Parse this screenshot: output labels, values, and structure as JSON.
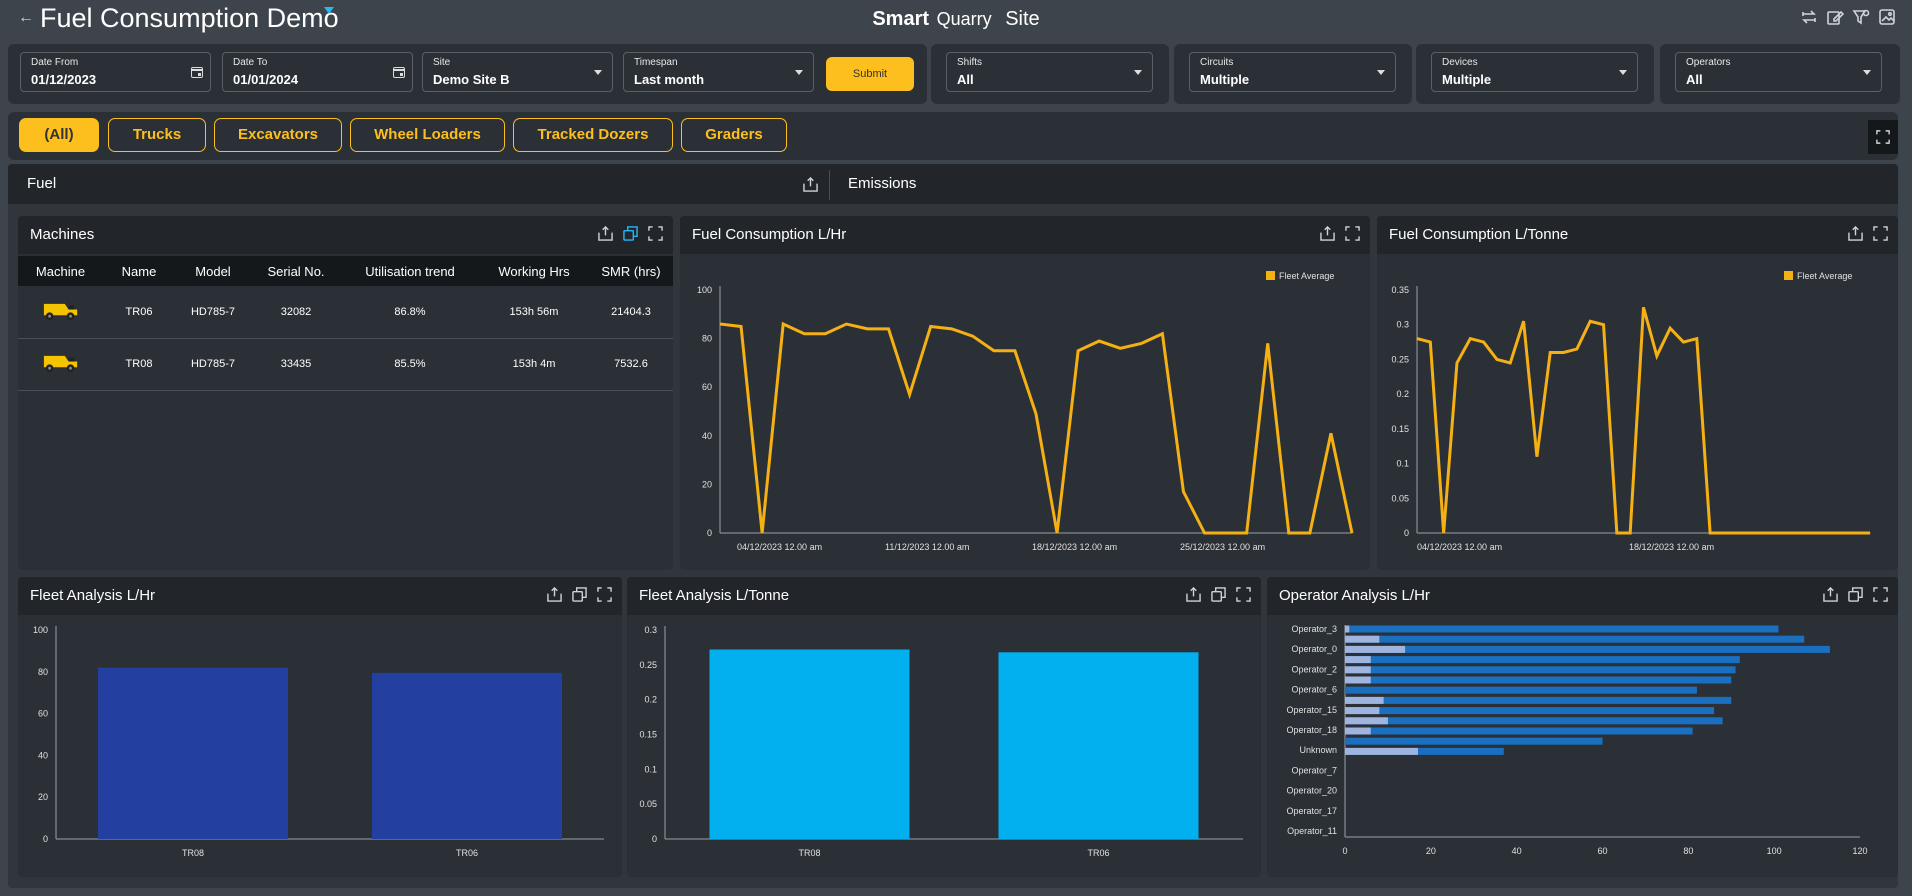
{
  "header": {
    "title": "Fuel Consumption Demo",
    "brand_bold": "Smart",
    "brand_mid": "Quarry",
    "brand_end": "Site"
  },
  "filters": {
    "date_from": {
      "label": "Date From",
      "value": "01/12/2023"
    },
    "date_to": {
      "label": "Date To",
      "value": "01/01/2024"
    },
    "site": {
      "label": "Site",
      "value": "Demo Site B"
    },
    "timespan": {
      "label": "Timespan",
      "value": "Last month"
    },
    "submit_label": "Submit",
    "shifts": {
      "label": "Shifts",
      "value": "All"
    },
    "circuits": {
      "label": "Circuits",
      "value": "Multiple"
    },
    "devices": {
      "label": "Devices",
      "value": "Multiple"
    },
    "operators": {
      "label": "Operators",
      "value": "All"
    }
  },
  "machine_tabs": [
    "(All)",
    "Trucks",
    "Excavators",
    "Wheel Loaders",
    "Tracked Dozers",
    "Graders"
  ],
  "section_tabs": {
    "fuel": "Fuel",
    "emissions": "Emissions"
  },
  "machines": {
    "title": "Machines",
    "columns": [
      "Machine",
      "Name",
      "Model",
      "Serial No.",
      "Utilisation trend",
      "Working Hrs",
      "SMR (hrs)"
    ],
    "rows": [
      {
        "icon": "haul-truck-icon",
        "name": "TR06",
        "model": "HD785-7",
        "serial": "32082",
        "util": "86.8%",
        "hrs": "153h 56m",
        "smr": "21404.3"
      },
      {
        "icon": "haul-truck-icon",
        "name": "TR08",
        "model": "HD785-7",
        "serial": "33435",
        "util": "85.5%",
        "hrs": "153h 4m",
        "smr": "7532.6"
      }
    ]
  },
  "colors": {
    "accent": "#fdbf1e",
    "line": "#f5b014",
    "bar_dark": "#2340a0",
    "bar_light": "#03b0ef",
    "op_bar": "#1a6fc0",
    "op_bar_light": "#9fb5e0"
  },
  "chart_data": [
    {
      "type": "line",
      "title": "Fuel Consumption L/Hr",
      "legend": [
        "Fleet Average"
      ],
      "ylim": [
        0,
        100
      ],
      "y_ticks": [
        0,
        20,
        40,
        60,
        80,
        100
      ],
      "x_tick_labels": [
        "04/12/2023 12.00 am",
        "11/12/2023 12.00 am",
        "18/12/2023 12.00 am",
        "25/12/2023 12.00 am"
      ],
      "series": [
        {
          "name": "Fleet Average",
          "values": [
            86,
            85,
            0,
            86,
            82,
            82,
            86,
            84,
            84,
            57,
            85,
            84,
            81,
            75,
            75,
            49,
            0,
            75,
            79,
            76,
            78,
            82,
            17,
            0,
            0,
            0,
            78,
            0,
            0,
            41,
            0
          ]
        }
      ]
    },
    {
      "type": "line",
      "title": "Fuel Consumption L/Tonne",
      "legend": [
        "Fleet Average"
      ],
      "ylim": [
        0,
        0.35
      ],
      "y_ticks": [
        0,
        0.05,
        0.1,
        0.15,
        0.2,
        0.25,
        0.3,
        0.35
      ],
      "x_tick_labels": [
        "04/12/2023 12.00 am",
        "18/12/2023 12.00 am"
      ],
      "series": [
        {
          "name": "Fleet Average",
          "values": [
            0.28,
            0.275,
            0,
            0.245,
            0.28,
            0.275,
            0.25,
            0.245,
            0.305,
            0.11,
            0.26,
            0.26,
            0.265,
            0.305,
            0.3,
            0,
            0,
            0.325,
            0.255,
            0.295,
            0.275,
            0.28,
            0,
            0,
            0,
            0,
            0,
            0,
            0,
            0,
            0,
            0,
            0,
            0,
            0
          ]
        }
      ]
    },
    {
      "type": "bar",
      "title": "Fleet Analysis L/Hr",
      "categories": [
        "TR08",
        "TR06"
      ],
      "values": [
        82,
        79.5
      ],
      "ylim": [
        0,
        100
      ],
      "y_ticks": [
        0,
        20,
        40,
        60,
        80,
        100
      ]
    },
    {
      "type": "bar",
      "title": "Fleet Analysis L/Tonne",
      "categories": [
        "TR08",
        "TR06"
      ],
      "values": [
        0.272,
        0.268
      ],
      "ylim": [
        0,
        0.3
      ],
      "y_ticks": [
        0,
        0.05,
        0.1,
        0.15,
        0.2,
        0.25,
        0.3
      ]
    },
    {
      "type": "bar",
      "orientation": "horizontal",
      "title": "Operator Analysis L/Hr",
      "xlim": [
        0,
        120
      ],
      "x_ticks": [
        0,
        20,
        40,
        60,
        80,
        100,
        120
      ],
      "category_labels": [
        "Operator_3",
        "Operator_0",
        "Operator_2",
        "Operator_6",
        "Operator_15",
        "Operator_18",
        "Unknown",
        "Operator_7",
        "Operator_20",
        "Operator_17",
        "Operator_11"
      ],
      "series": [
        {
          "values": [
            101,
            107,
            113,
            92,
            91,
            90,
            82,
            90,
            86,
            88,
            81,
            60,
            37,
            0,
            0,
            0,
            0,
            0,
            0,
            0,
            0
          ]
        },
        {
          "values": [
            1,
            8,
            14,
            6,
            6,
            6,
            0,
            9,
            8,
            10,
            6,
            0,
            17,
            0,
            0,
            0,
            0,
            0,
            0,
            0,
            0
          ]
        }
      ]
    }
  ]
}
